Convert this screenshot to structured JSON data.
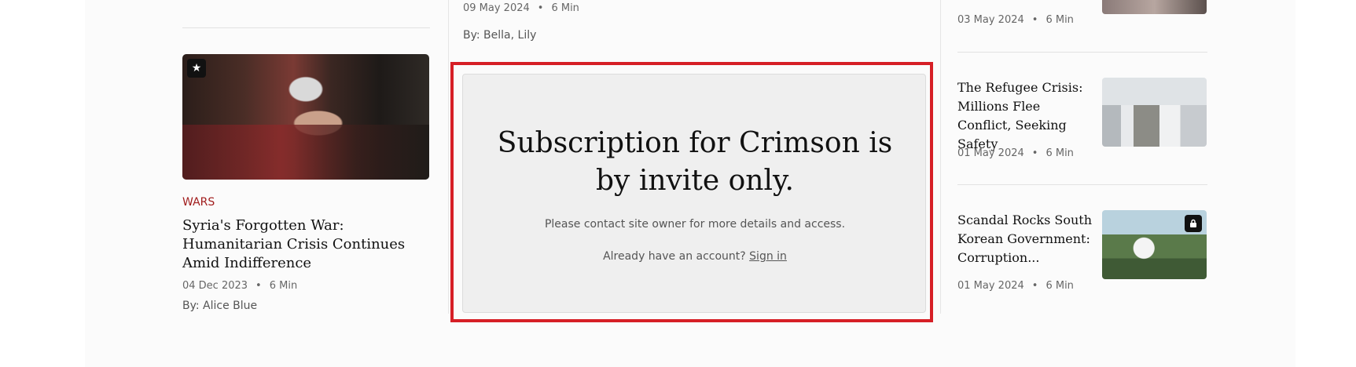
{
  "left_article": {
    "category": "WARS",
    "title": "Syria's Forgotten War: Humanitarian Crisis Continues Amid Indifference",
    "date": "04 Dec 2023",
    "read_time": "6 Min",
    "byline": "By: Alice Blue"
  },
  "center_article": {
    "date": "09 May 2024",
    "read_time": "6 Min",
    "byline": "By: Bella, Lily"
  },
  "paywall": {
    "title": "Subscription for Crimson is by invite only.",
    "message": "Please contact site owner for more details and access.",
    "account_prompt": "Already have an account?",
    "signin_label": "Sign in",
    "highlight_color": "#d61f26"
  },
  "right_articles": [
    {
      "date": "03 May 2024",
      "read_time": "6 Min"
    },
    {
      "title": "The Refugee Crisis: Millions Flee Conflict, Seeking Safety",
      "date": "01 May 2024",
      "read_time": "6 Min"
    },
    {
      "title": "Scandal Rocks South Korean Government: Corruption...",
      "date": "01 May 2024",
      "read_time": "6 Min"
    }
  ],
  "separator": "•",
  "icons": {
    "featured": "star-icon",
    "locked": "lock-icon"
  }
}
